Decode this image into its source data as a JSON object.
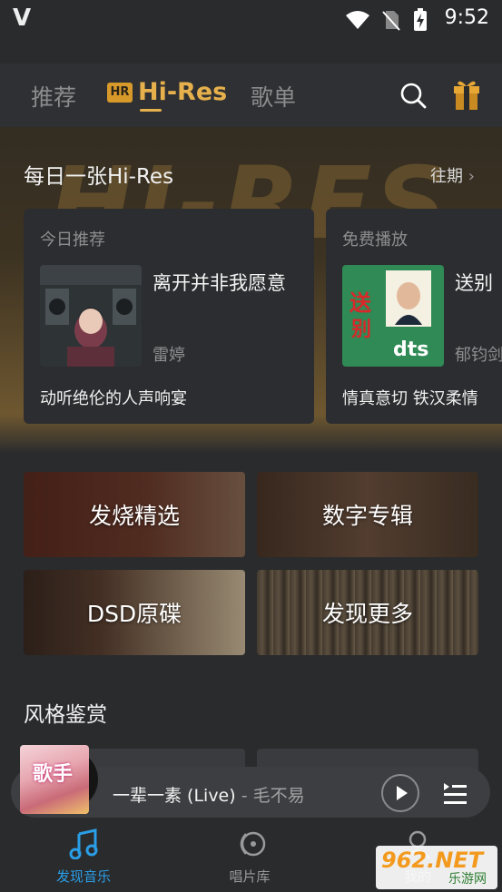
{
  "status_bar": {
    "time": "9:52"
  },
  "top_tabs": {
    "recommend": "推荐",
    "hires_badge": "HR",
    "hires": "Hi-Res",
    "playlist": "歌单"
  },
  "daily": {
    "title": "每日一张Hi-Res",
    "past": "往期",
    "background_word": "HI-RES",
    "cards": [
      {
        "tag": "今日推荐",
        "song": "离开并非我愿意",
        "artist": "雷婷",
        "desc": "动听绝伦的人声响宴"
      },
      {
        "tag": "免费播放",
        "song": "送别",
        "artist": "郁钧剑",
        "desc": "情真意切 铁汉柔情"
      }
    ]
  },
  "categories": [
    "发烧精选",
    "数字专辑",
    "DSD原碟",
    "发现更多"
  ],
  "style_section": {
    "title": "风格鉴赏"
  },
  "mini_player": {
    "cover_text": "歌手",
    "song": "一辈一素 (Live)",
    "separator": " - ",
    "artist": "毛不易"
  },
  "bottom_nav": {
    "discover": "发现音乐",
    "records": "唱片库",
    "me": "我的"
  },
  "watermark": {
    "main": "962.NET",
    "sub": "乐游网"
  },
  "colors": {
    "accent_gold": "#e6b04c",
    "accent_blue": "#2a9ee6",
    "background": "#2a2b2d"
  }
}
